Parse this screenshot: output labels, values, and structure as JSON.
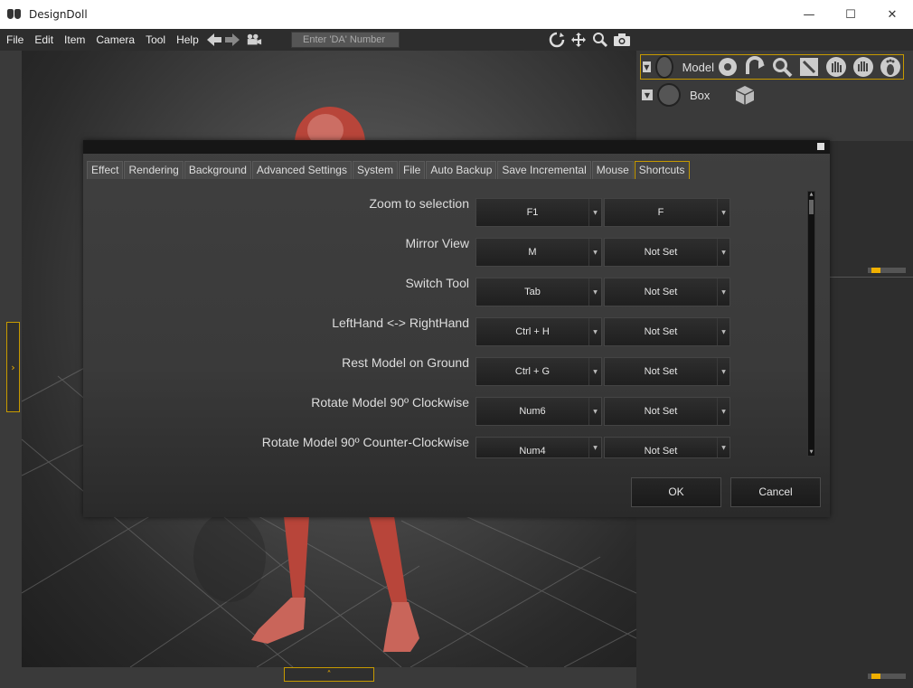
{
  "window": {
    "title": "DesignDoll",
    "minimize": "—",
    "maximize": "☐",
    "close": "✕"
  },
  "menu": {
    "items": [
      "File",
      "Edit",
      "Item",
      "Camera",
      "Tool",
      "Help"
    ]
  },
  "toolbar": {
    "da_placeholder": "Enter 'DA' Number"
  },
  "scene_tree": {
    "items": [
      {
        "label": "Model",
        "selected": true
      },
      {
        "label": "Box",
        "selected": false
      }
    ]
  },
  "colors": {
    "accent": "#f0b000",
    "accent_border": "#c79a00",
    "figure": "#b8453a"
  },
  "dialog": {
    "tabs": [
      "Effect",
      "Rendering",
      "Background",
      "Advanced Settings",
      "System",
      "File",
      "Auto Backup",
      "Save Incremental",
      "Mouse",
      "Shortcuts"
    ],
    "active_tab": "Shortcuts",
    "shortcuts": [
      {
        "label": "Zoom to selection",
        "primary": "F1",
        "secondary": "F"
      },
      {
        "label": "Mirror View",
        "primary": "M",
        "secondary": "Not Set"
      },
      {
        "label": "Switch Tool",
        "primary": "Tab",
        "secondary": "Not Set"
      },
      {
        "label": "LeftHand <-> RightHand",
        "primary": "Ctrl + H",
        "secondary": "Not Set"
      },
      {
        "label": "Rest Model on Ground",
        "primary": "Ctrl + G",
        "secondary": "Not Set"
      },
      {
        "label": "Rotate Model 90º Clockwise",
        "primary": "Num6",
        "secondary": "Not Set"
      },
      {
        "label": "Rotate Model 90º Counter-Clockwise",
        "primary": "Num4",
        "secondary": "Not Set"
      }
    ],
    "ok_label": "OK",
    "cancel_label": "Cancel"
  }
}
